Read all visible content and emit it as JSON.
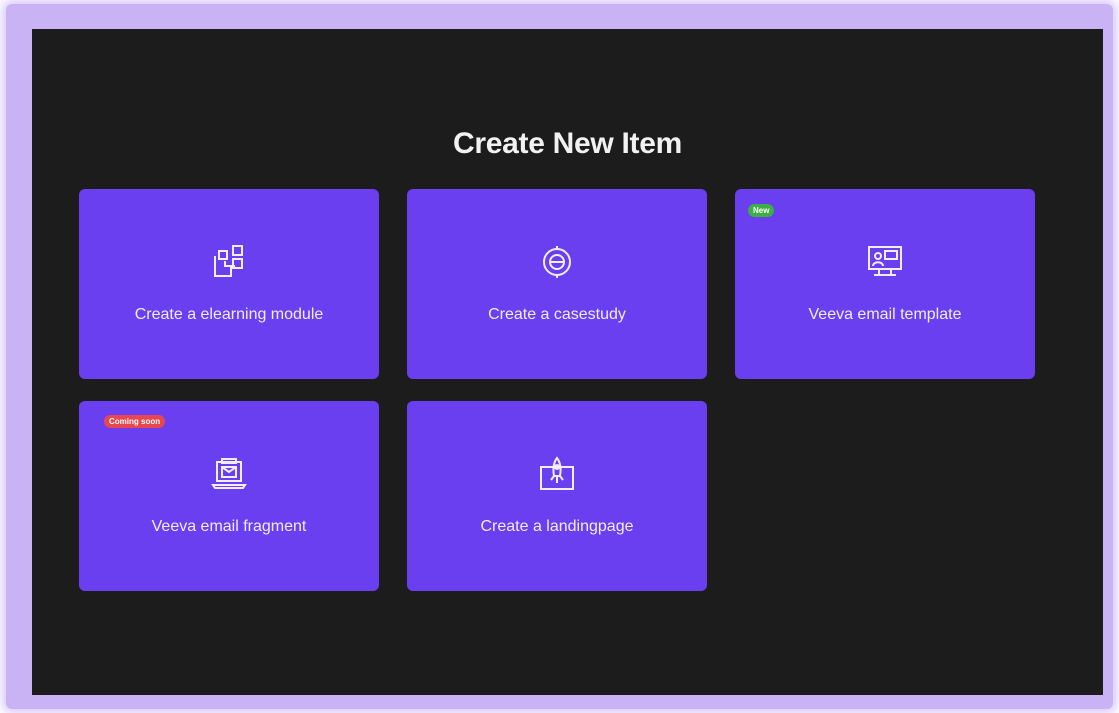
{
  "modal": {
    "title": "Create New Item"
  },
  "colors": {
    "card_background": "#6a3ff0",
    "modal_background": "#1c1c1c",
    "frame_glow": "#c9b3f5",
    "badge_new": "#3cb043",
    "badge_coming_soon": "#e8474f"
  },
  "cards": [
    {
      "label": "Create a elearning module",
      "icon": "elearning-blocks-icon",
      "badge": null
    },
    {
      "label": "Create a casestudy",
      "icon": "casestudy-target-icon",
      "badge": null
    },
    {
      "label": "Veeva email template",
      "icon": "email-template-monitor-icon",
      "badge": "New"
    },
    {
      "label": "Veeva email fragment",
      "icon": "email-fragment-laptop-icon",
      "badge": "Coming soon"
    },
    {
      "label": "Create a landingpage",
      "icon": "landingpage-rocket-icon",
      "badge": null
    }
  ]
}
